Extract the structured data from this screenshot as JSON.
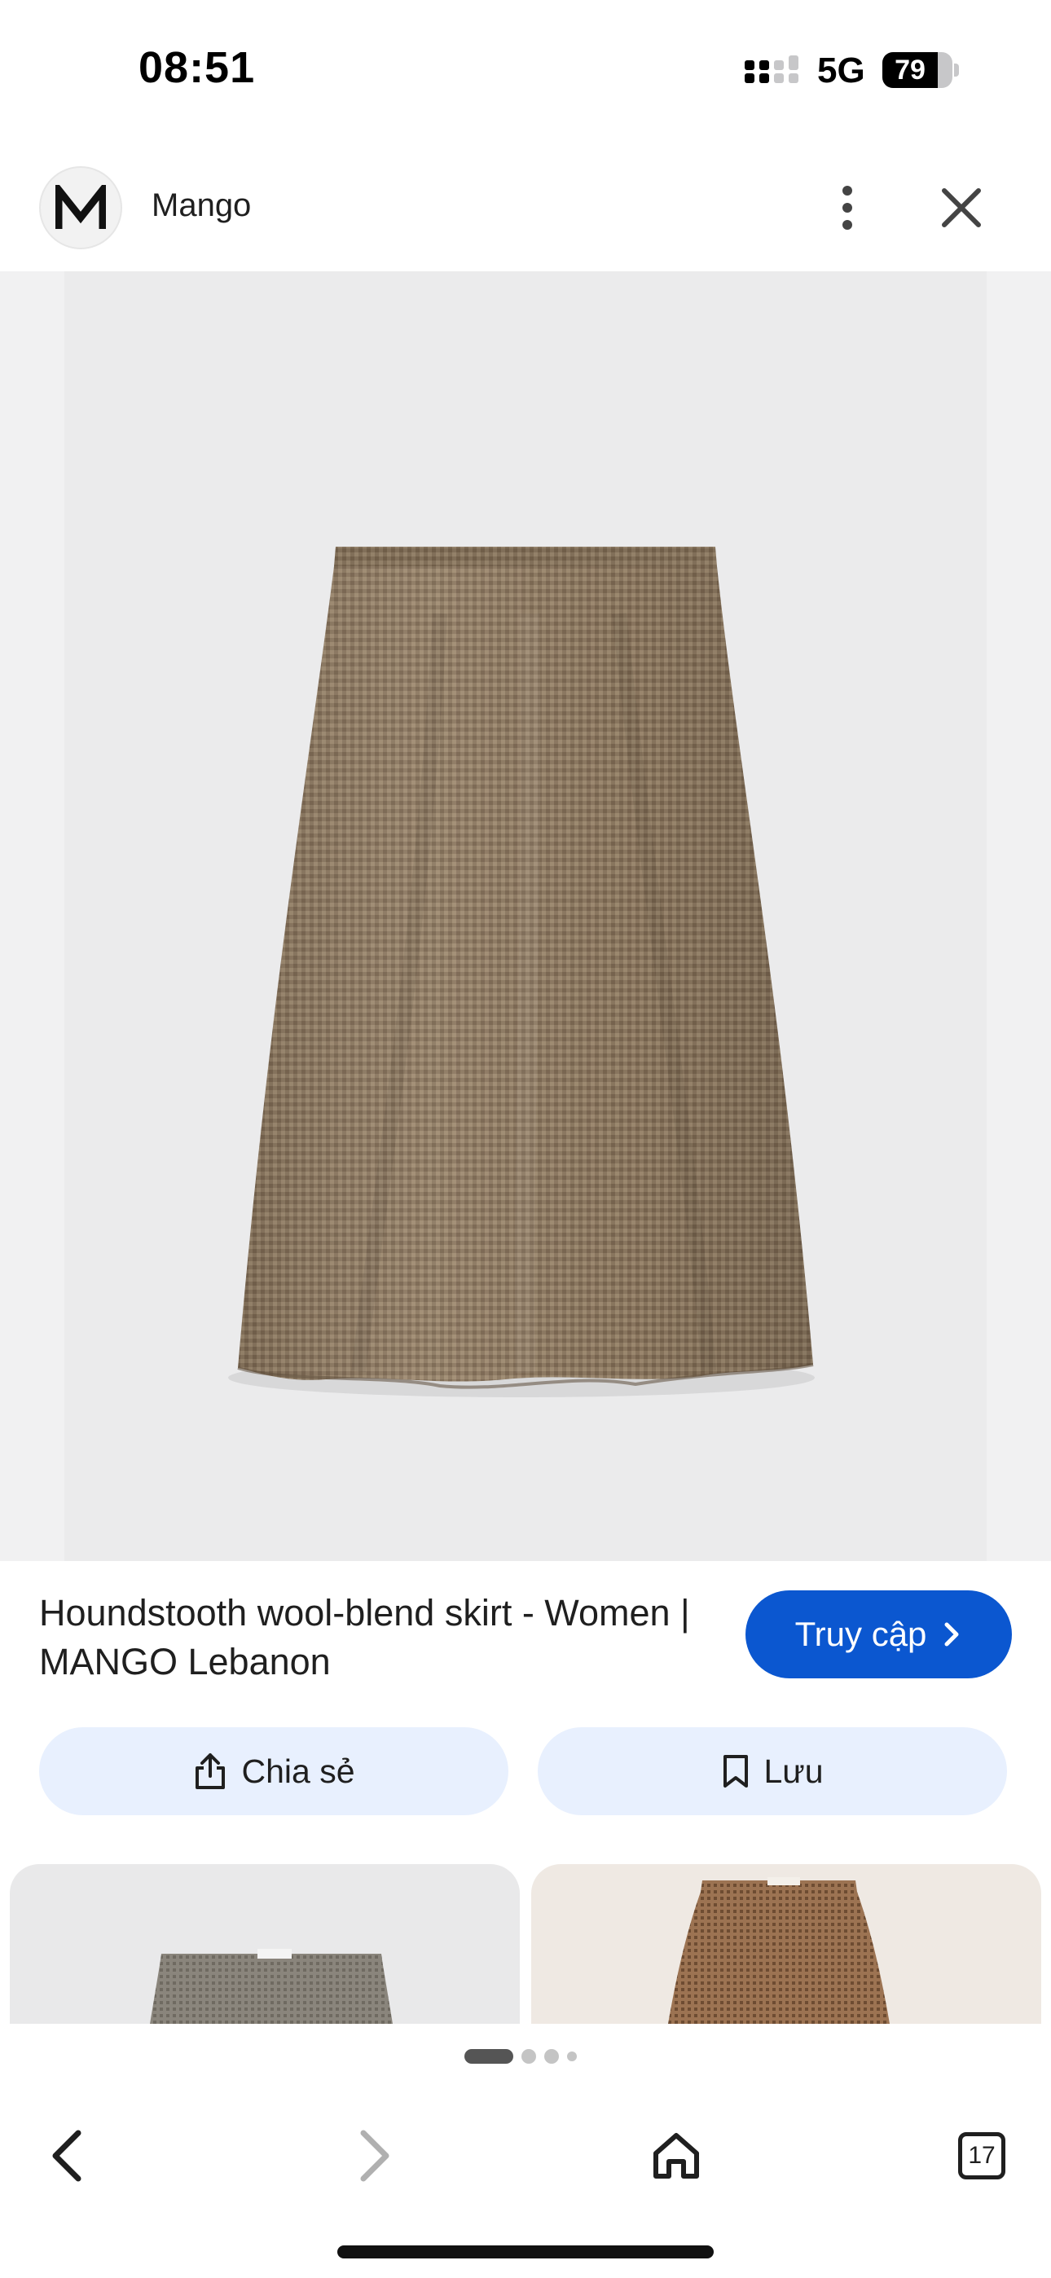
{
  "status_bar": {
    "time": "08:51",
    "network": "5G",
    "battery_percent": "79",
    "battery_level": 0.79
  },
  "header": {
    "site_logo_letter": "M",
    "site_name": "Mango",
    "more_icon": "more-vert-icon",
    "close_icon": "close-icon"
  },
  "product": {
    "title": "Houndstooth wool-blend skirt - Women | MANGO Lebanon",
    "visit_label": "Truy cập",
    "visit_icon": "chevron-right-icon"
  },
  "actions": {
    "share_label": "Chia sẻ",
    "share_icon": "share-icon",
    "save_label": "Lưu",
    "save_icon": "bookmark-icon"
  },
  "pager": {
    "page_count": 4,
    "active_page": 1
  },
  "toolbar": {
    "back_icon": "chevron-left-icon",
    "forward_icon": "chevron-right-icon",
    "home_icon": "home-icon",
    "tab_count": "17"
  },
  "colors": {
    "accent": "#0b57d0",
    "button_tint": "#e8f0fe",
    "skirt": "#8f7a62"
  }
}
